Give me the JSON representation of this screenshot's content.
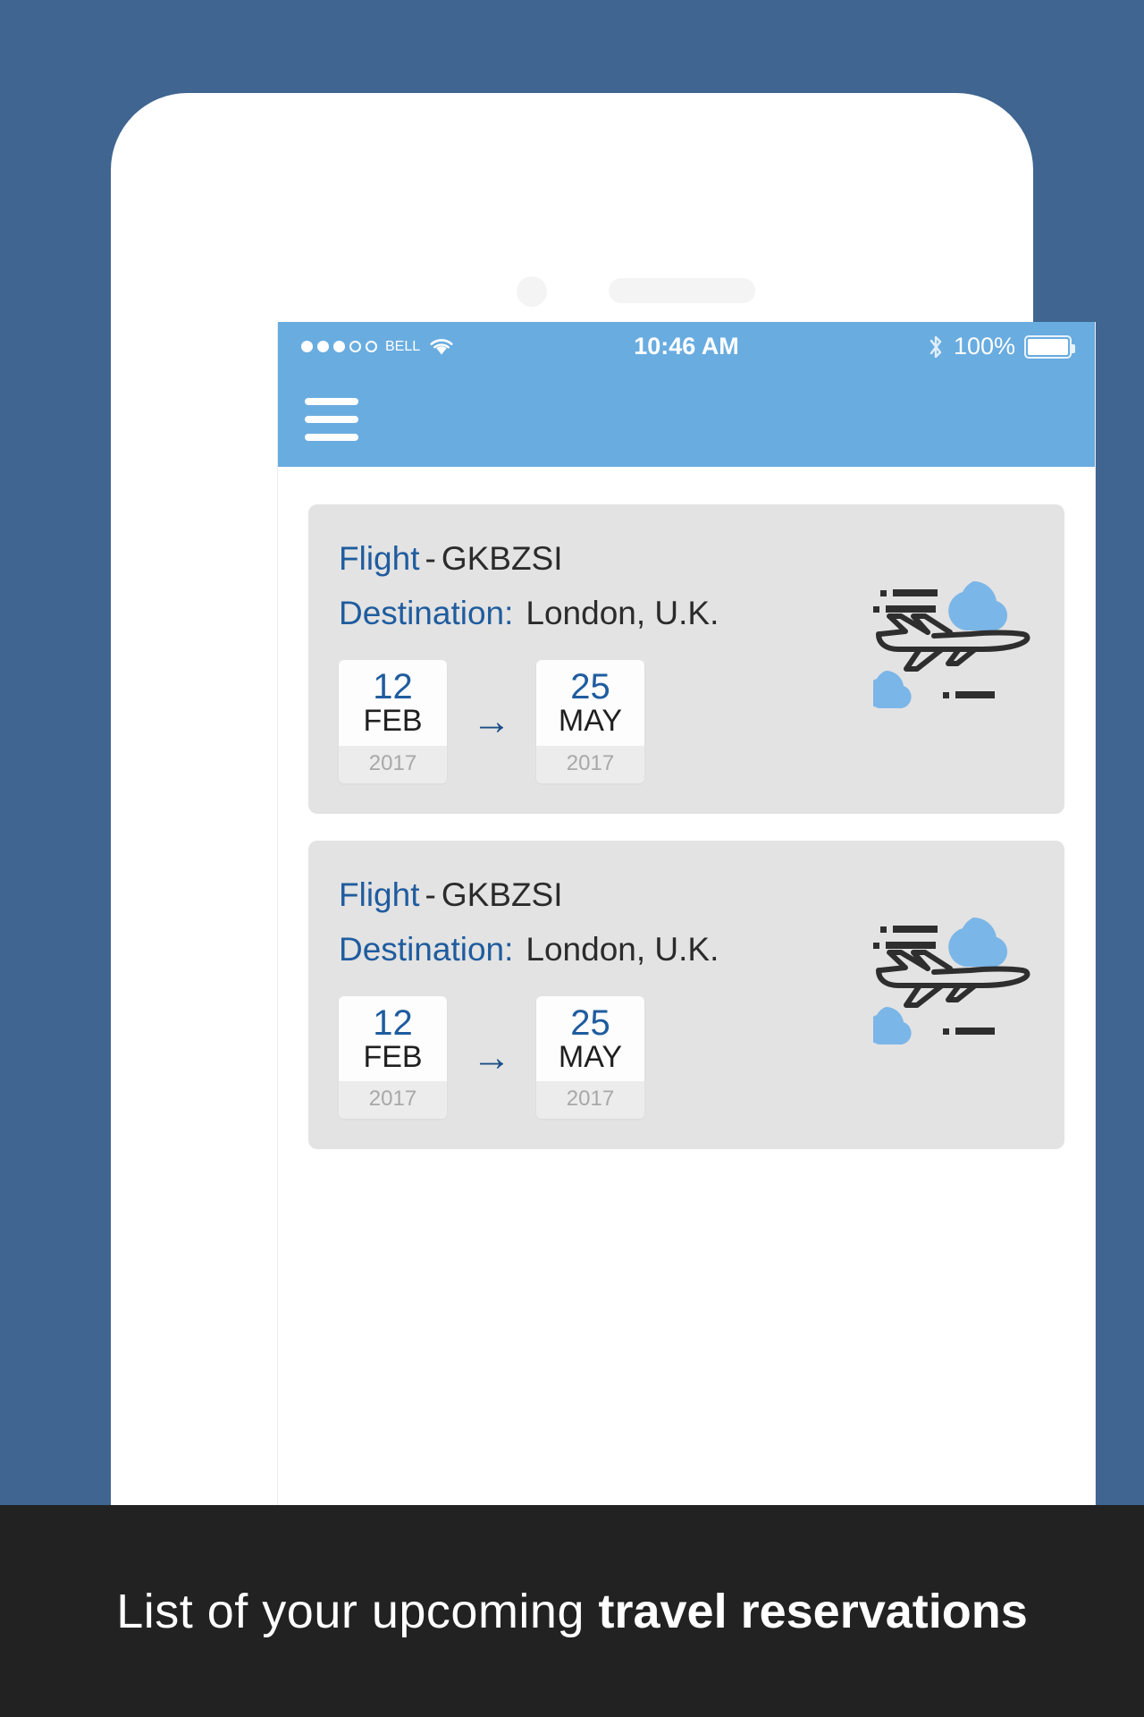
{
  "status_bar": {
    "carrier": "BELL",
    "signal_dots_total": 5,
    "signal_dots_filled": 3,
    "wifi_icon": "wifi-icon",
    "time": "10:46 AM",
    "bluetooth_icon": "bluetooth-icon",
    "battery_percent": "100%",
    "battery_icon": "battery-full-icon"
  },
  "app_bar": {
    "menu_icon": "hamburger-menu-icon",
    "background_color": "#69ACE0"
  },
  "flights": [
    {
      "flight_label": "Flight",
      "separator": "-",
      "flight_code": "GKBZSI",
      "destination_label": "Destination:",
      "destination_value": "London, U.K.",
      "depart": {
        "day": "12",
        "month": "FEB",
        "year": "2017"
      },
      "arrive": {
        "day": "25",
        "month": "MAY",
        "year": "2017"
      },
      "arrow": "→",
      "artwork_icon": "airplane-clouds-icon"
    },
    {
      "flight_label": "Flight",
      "separator": "-",
      "flight_code": "GKBZSI",
      "destination_label": "Destination:",
      "destination_value": "London, U.K.",
      "depart": {
        "day": "12",
        "month": "FEB",
        "year": "2017"
      },
      "arrive": {
        "day": "25",
        "month": "MAY",
        "year": "2017"
      },
      "arrow": "→",
      "artwork_icon": "airplane-clouds-icon"
    }
  ],
  "caption": {
    "light_part": "List of your upcoming ",
    "bold_part": "travel reservations"
  },
  "colors": {
    "page_background": "#3F6590",
    "header_blue": "#69ACE0",
    "accent_blue": "#1F5C9E",
    "card_gray": "#E3E3E3",
    "cloud_blue": "#7BB6E8",
    "plane_dark": "#2E2E2E",
    "caption_bar": "#222222"
  }
}
